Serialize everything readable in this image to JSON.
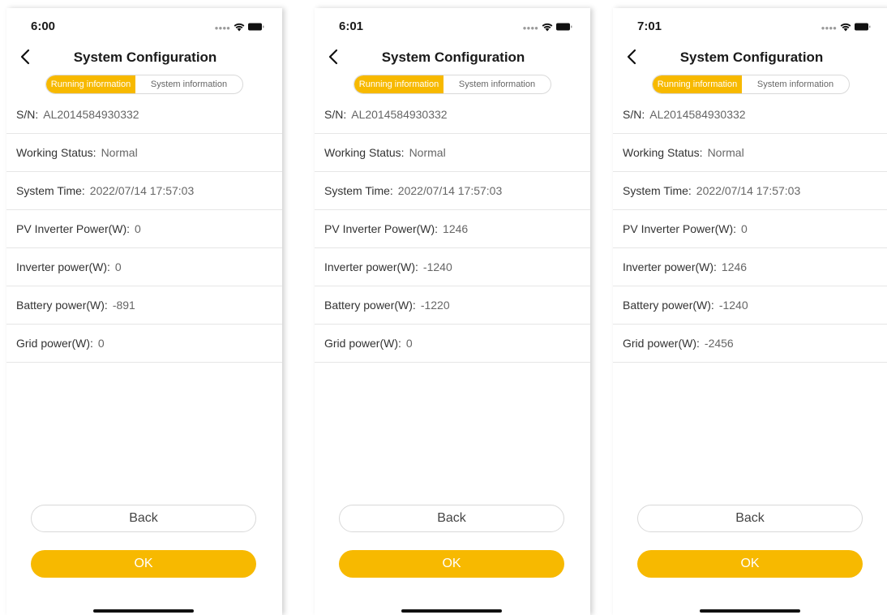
{
  "colors": {
    "accent": "#f7b900",
    "value_text": "#666666",
    "divider": "#e6e6e6"
  },
  "screens": [
    {
      "time": "6:00",
      "title": "System Configuration",
      "tabs": {
        "active": "Running information",
        "inactive": "System information"
      },
      "rows": [
        {
          "label": "S/N",
          "value": "AL2014584930332"
        },
        {
          "label": "Working Status",
          "value": "Normal"
        },
        {
          "label": "System Time",
          "value": "2022/07/14 17:57:03"
        },
        {
          "label": "PV Inverter Power(W)",
          "value": "0"
        },
        {
          "label": "Inverter power(W)",
          "value": "0"
        },
        {
          "label": "Battery power(W)",
          "value": "-891"
        },
        {
          "label": "Grid power(W)",
          "value": "0"
        }
      ],
      "back_label": "Back",
      "ok_label": "OK"
    },
    {
      "time": "6:01",
      "title": "System Configuration",
      "tabs": {
        "active": "Running information",
        "inactive": "System information"
      },
      "rows": [
        {
          "label": "S/N",
          "value": "AL2014584930332"
        },
        {
          "label": "Working Status",
          "value": "Normal"
        },
        {
          "label": "System Time",
          "value": "2022/07/14 17:57:03"
        },
        {
          "label": "PV Inverter Power(W)",
          "value": "1246"
        },
        {
          "label": "Inverter power(W)",
          "value": "-1240"
        },
        {
          "label": "Battery power(W)",
          "value": "-1220"
        },
        {
          "label": "Grid power(W)",
          "value": "0"
        }
      ],
      "back_label": "Back",
      "ok_label": "OK"
    },
    {
      "time": "7:01",
      "title": "System Configuration",
      "tabs": {
        "active": "Running information",
        "inactive": "System information"
      },
      "rows": [
        {
          "label": "S/N",
          "value": "AL2014584930332"
        },
        {
          "label": "Working Status",
          "value": "Normal"
        },
        {
          "label": "System Time",
          "value": "2022/07/14 17:57:03"
        },
        {
          "label": "PV Inverter Power(W)",
          "value": "0"
        },
        {
          "label": "Inverter power(W)",
          "value": "1246"
        },
        {
          "label": "Battery power(W)",
          "value": "-1240"
        },
        {
          "label": "Grid power(W)",
          "value": "-2456"
        }
      ],
      "back_label": "Back",
      "ok_label": "OK"
    }
  ]
}
